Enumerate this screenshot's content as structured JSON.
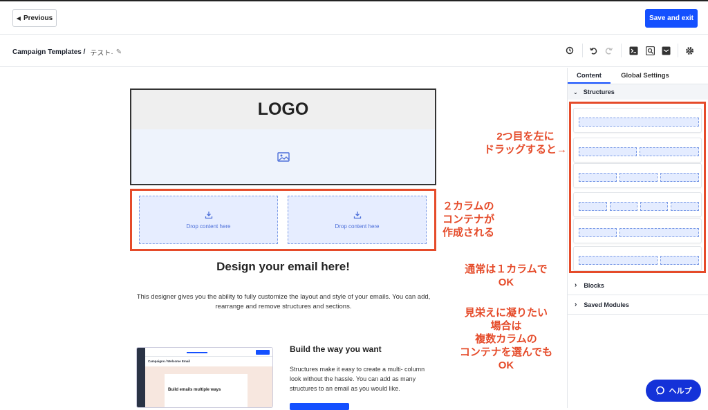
{
  "header": {
    "previous_label": "Previous",
    "save_label": "Save and exit"
  },
  "breadcrumb": {
    "root": "Campaign Templates /",
    "name": "テスト·"
  },
  "toolbar_icons": [
    "history-icon",
    "undo-icon",
    "redo-icon",
    "code-icon",
    "preview-icon",
    "test-email-icon",
    "settings-icon"
  ],
  "panel": {
    "tabs": [
      "Content",
      "Global Settings"
    ],
    "structures_label": "Structures",
    "blocks_label": "Blocks",
    "saved_modules_label": "Saved Modules"
  },
  "email": {
    "logo_text": "LOGO",
    "drop_left": "Drop content here",
    "drop_right": "Drop content here",
    "title": "Design your email here!",
    "description": "This designer gives you the ability to fully customize the layout and style of your emails. You can add, rearrange and remove structures and sections.",
    "section_title": "Build the way you want",
    "section_text": "Structures make it easy to create a multi- column look without the hassle. You can add as many structures to an email as you would like."
  },
  "thumbnail": {
    "crumb": "Campaigns / Welcome Email",
    "card_title": "Build emails multiple ways"
  },
  "annotations": {
    "drag_tip": "2つ目を左に\nドラッグすると→",
    "two_col": "２カラムの\nコンテナが\n作成される",
    "normal": "通常は１カラムで\nOK",
    "fancy": "見栄えに凝りたい\n場合は\n複数カラムの\nコンテナを選んでも\nOK"
  },
  "help_label": "ヘルプ",
  "colors": {
    "accent": "#1450ff",
    "annotation": "#e54b2a"
  }
}
